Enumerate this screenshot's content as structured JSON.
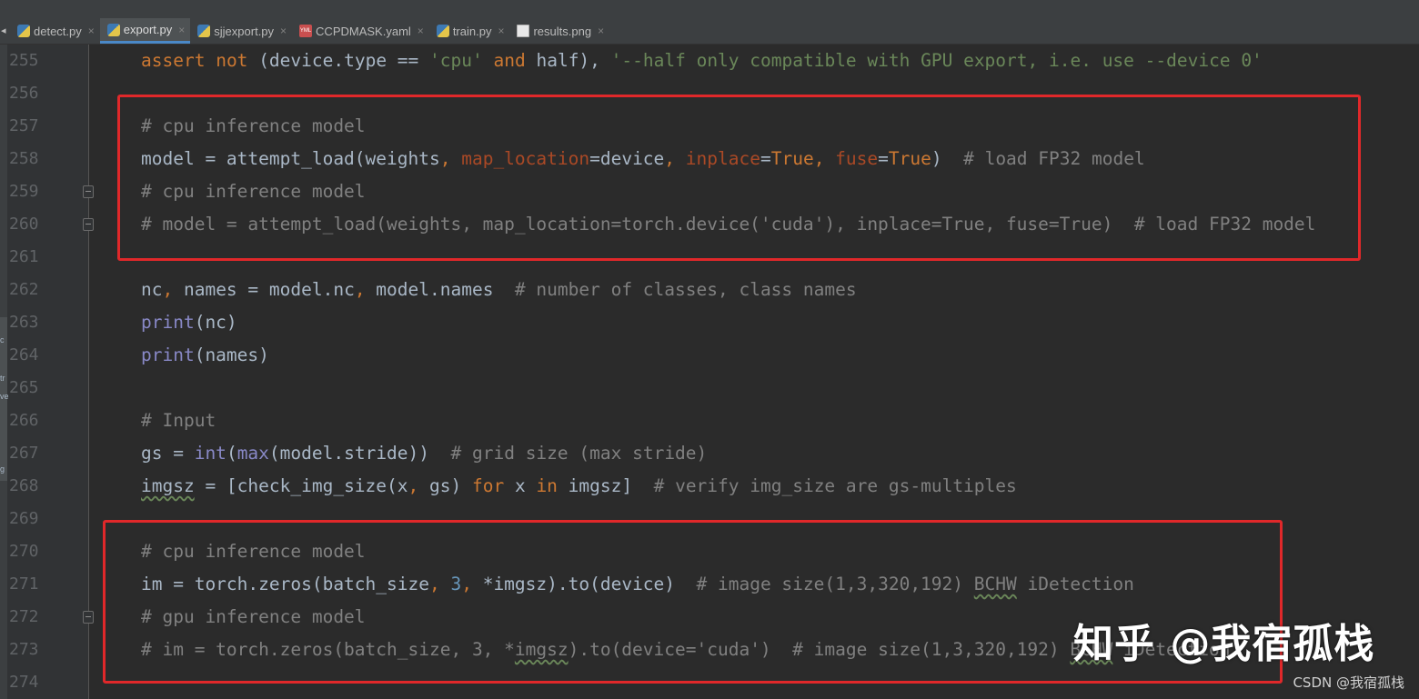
{
  "tabs": [
    {
      "label": "detect.py",
      "icon": "python-file-icon",
      "active": false
    },
    {
      "label": "export.py",
      "icon": "python-file-icon",
      "active": true
    },
    {
      "label": "sjjexport.py",
      "icon": "python-file-icon",
      "active": false
    },
    {
      "label": "CCPDMASK.yaml",
      "icon": "yaml-file-icon",
      "active": false
    },
    {
      "label": "train.py",
      "icon": "python-file-icon",
      "active": false
    },
    {
      "label": "results.png",
      "icon": "image-file-icon",
      "active": false
    }
  ],
  "yml_badge": "YML",
  "line_numbers": [
    "255",
    "256",
    "257",
    "258",
    "259",
    "260",
    "261",
    "262",
    "263",
    "264",
    "265",
    "266",
    "267",
    "268",
    "269",
    "270",
    "271",
    "272",
    "273",
    "274"
  ],
  "code": {
    "l255": [
      "assert",
      "not",
      "(device.type == ",
      "'cpu'",
      "and",
      "half), ",
      "'--half only compatible with GPU export, i.e. use --device 0'"
    ],
    "l257": "# cpu inference model",
    "l258": [
      "model = attempt_load(weights",
      ", ",
      "map_location",
      "=device",
      ", ",
      "inplace",
      "=",
      "True",
      ", ",
      "fuse",
      "=",
      "True",
      ")  ",
      "# load FP32 model"
    ],
    "l259": "# cpu inference model",
    "l260": "# model = attempt_load(weights, map_location=torch.device('cuda'), inplace=True, fuse=True)  # load FP32 model",
    "l262": [
      "nc",
      ", ",
      "names = model.nc",
      ", ",
      "model.names  ",
      "# number of classes, class names"
    ],
    "l263": [
      "print",
      "(nc)"
    ],
    "l264": [
      "print",
      "(names)"
    ],
    "l266": "# Input",
    "l267": [
      "gs = ",
      "int",
      "(",
      "max",
      "(model.stride))  ",
      "# grid size (max stride)"
    ],
    "l268": [
      "imgsz",
      " = [check_img_size(x",
      ", ",
      "gs) ",
      "for",
      " x ",
      "in",
      " imgsz]  ",
      "# verify img_size are gs-multiples"
    ],
    "l270": "# cpu inference model",
    "l271": [
      "im = torch.zeros(batch_size",
      ", ",
      "3",
      ", ",
      "*imgsz).to(device)  ",
      "# image size(1,3,320,192) ",
      "BCHW",
      " iDetection"
    ],
    "l272": "# gpu inference model",
    "l273": [
      "# im = torch.zeros(batch_size, 3, *",
      "imgsz",
      ").to(device='cuda')  # image size(1,3,320,192) ",
      "BCHW",
      " iDetection"
    ]
  },
  "watermark": "知乎 @我宿孤栈",
  "csdn_credit": "CSDN @我宿孤栈",
  "sidebar_marks": [
    "c",
    "tr",
    "ve",
    "g"
  ],
  "colors": {
    "highlight_box": "#e0282a",
    "keyword": "#cc7832",
    "string": "#6a8759",
    "comment": "#808080",
    "builtin": "#8888c6",
    "number": "#6897bb",
    "parameter": "#aa4926"
  }
}
